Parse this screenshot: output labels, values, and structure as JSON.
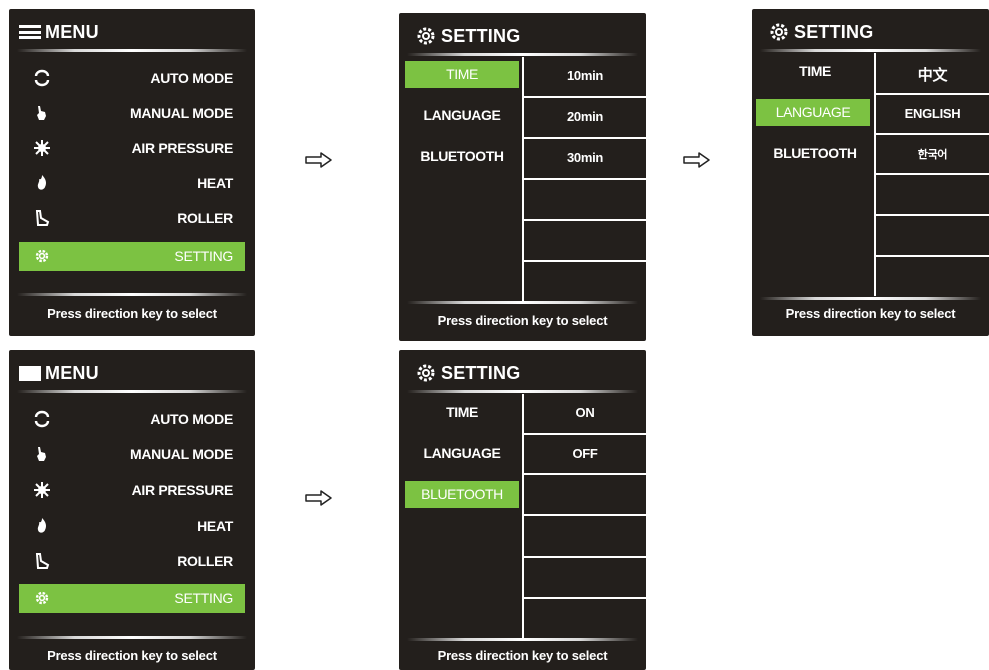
{
  "menu": {
    "title": "MENU",
    "items": [
      {
        "label": "AUTO MODE",
        "icon": "refresh-icon"
      },
      {
        "label": "MANUAL MODE",
        "icon": "hand-icon"
      },
      {
        "label": "AIR PRESSURE",
        "icon": "air-icon"
      },
      {
        "label": "HEAT",
        "icon": "flame-icon"
      },
      {
        "label": "ROLLER",
        "icon": "roller-icon"
      },
      {
        "label": "SETTING",
        "icon": "gear-icon"
      }
    ],
    "selected": "SETTING",
    "footer": "Press direction key to select"
  },
  "setting": {
    "title": "SETTING",
    "items": [
      "TIME",
      "LANGUAGE",
      "BLUETOOTH"
    ],
    "footer": "Press direction key to select"
  },
  "time_screen": {
    "selected": "TIME",
    "options": [
      "10min",
      "20min",
      "30min"
    ]
  },
  "language_screen": {
    "selected": "LANGUAGE",
    "options": [
      "中文",
      "ENGLISH",
      "한국어"
    ]
  },
  "bluetooth_screen": {
    "selected": "BLUETOOTH",
    "options": [
      "ON",
      "OFF"
    ]
  },
  "colors": {
    "screen_bg": "#231f1c",
    "highlight": "#7cc242",
    "text": "#ffffff"
  }
}
